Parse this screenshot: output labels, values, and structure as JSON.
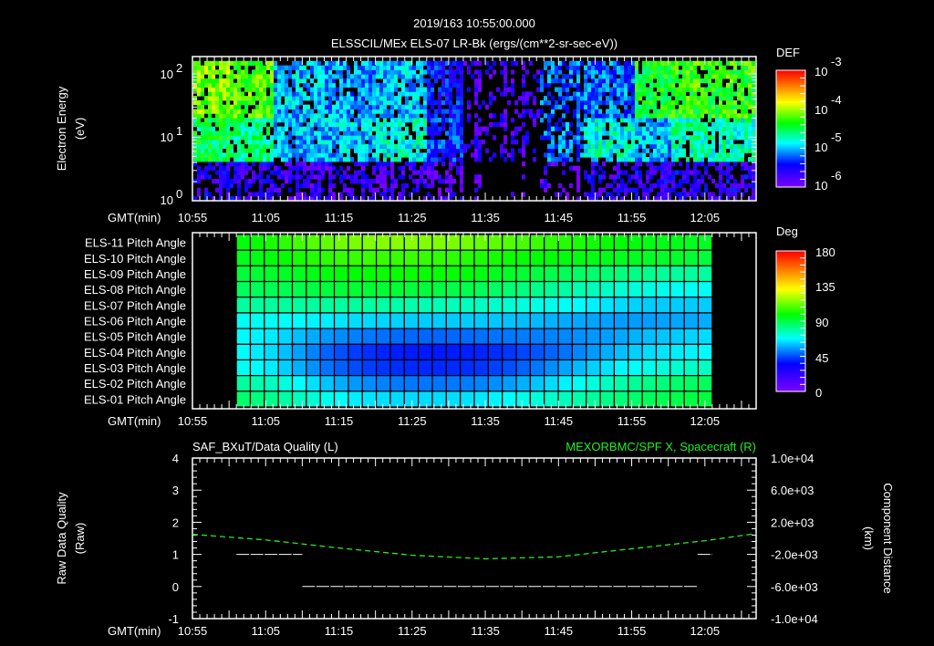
{
  "header": {
    "timestamp": "2019/163 10:55:00.000",
    "title": "ELSSCIL/MEx ELS-07 LR-Bk  (ergs/(cm**2-sr-sec-eV))"
  },
  "axis_time": {
    "label": "GMT(min)",
    "ticks": [
      "10:55",
      "11:05",
      "11:15",
      "11:25",
      "11:35",
      "11:45",
      "11:55",
      "12:05"
    ],
    "range": [
      "10:55",
      "12:12"
    ]
  },
  "chart_data": [
    {
      "type": "heatmap",
      "ylabel": "Electron Energy",
      "yunit": "(eV)",
      "yscale": "log",
      "ylim": [
        1,
        180
      ],
      "yticks": [
        "10",
        "10",
        "10"
      ],
      "ytick_exp": [
        "0",
        "1",
        "2"
      ],
      "colorbar": {
        "title": "DEF",
        "scale": "log",
        "range": [
          1e-06,
          0.001
        ],
        "labels": [
          "10",
          "10",
          "10",
          "10"
        ],
        "label_exp": [
          "-3",
          "-4",
          "-5",
          "-6"
        ]
      },
      "colormap": [
        "#7f00ff",
        "#0000ff",
        "#00ffff",
        "#00ff00",
        "#ffff00",
        "#ff0000"
      ],
      "bands": [
        "low 1-4 eV",
        "mid 4-20 eV",
        "high 20-180 eV"
      ],
      "time_bins": [
        {
          "t": "10:55",
          "log_def": [
            -5.6,
            -4.5,
            -4.1
          ],
          "coverage": 0.85
        },
        {
          "t": "11:00",
          "log_def": [
            -5.6,
            -4.6,
            -4.2
          ],
          "coverage": 0.85
        },
        {
          "t": "11:06",
          "log_def": [
            -5.7,
            -5.0,
            -5.0
          ],
          "coverage": 0.85
        },
        {
          "t": "11:13",
          "log_def": [
            -5.7,
            -5.0,
            -5.1
          ],
          "coverage": 0.85
        },
        {
          "t": "11:20",
          "log_def": [
            -5.7,
            -4.8,
            -5.0
          ],
          "coverage": 0.85
        },
        {
          "t": "11:27",
          "log_def": [
            -5.8,
            -5.3,
            -5.4
          ],
          "coverage": 0.75
        },
        {
          "t": "11:32",
          "log_def": [
            -5.9,
            -5.7,
            -5.7
          ],
          "coverage": 0.2
        },
        {
          "t": "11:42",
          "log_def": [
            -5.8,
            -5.2,
            -5.2
          ],
          "coverage": 0.55
        },
        {
          "t": "11:48",
          "log_def": [
            -5.6,
            -4.8,
            -5.2
          ],
          "coverage": 0.85
        },
        {
          "t": "11:55",
          "log_def": [
            -5.6,
            -5.0,
            -4.4
          ],
          "coverage": 0.85
        },
        {
          "t": "12:00",
          "log_def": [
            -5.6,
            -4.7,
            -4.3
          ],
          "coverage": 0.85
        }
      ]
    },
    {
      "type": "heatmap",
      "rows": [
        "ELS-11 Pitch Angle",
        "ELS-10 Pitch Angle",
        "ELS-09 Pitch Angle",
        "ELS-08 Pitch Angle",
        "ELS-07 Pitch Angle",
        "ELS-06 Pitch Angle",
        "ELS-05 Pitch Angle",
        "ELS-04 Pitch Angle",
        "ELS-03 Pitch Angle",
        "ELS-02 Pitch Angle",
        "ELS-01 Pitch Angle"
      ],
      "time_range": [
        "11:01",
        "12:06"
      ],
      "colorbar": {
        "title": "Deg",
        "range": [
          0,
          180
        ],
        "labels": [
          "180",
          "135",
          "90",
          "45",
          "0"
        ]
      },
      "values_deg": [
        [
          98,
          102,
          108,
          112,
          115,
          116,
          116,
          115,
          113,
          110,
          107,
          104,
          101,
          99,
          97,
          96,
          95
        ],
        [
          96,
          98,
          102,
          105,
          106,
          106,
          106,
          105,
          103,
          101,
          99,
          98,
          97,
          96,
          95,
          94,
          92
        ],
        [
          92,
          94,
          96,
          98,
          99,
          100,
          100,
          100,
          98,
          95,
          92,
          89,
          86,
          84,
          82,
          80,
          80
        ],
        [
          88,
          89,
          90,
          92,
          93,
          93,
          92,
          91,
          89,
          86,
          83,
          80,
          77,
          74,
          72,
          70,
          70
        ],
        [
          80,
          80,
          80,
          80,
          80,
          79,
          78,
          77,
          76,
          74,
          72,
          70,
          67,
          64,
          62,
          62,
          62
        ],
        [
          70,
          70,
          68,
          66,
          64,
          63,
          62,
          62,
          62,
          61,
          60,
          58,
          57,
          56,
          56,
          57,
          58
        ],
        [
          68,
          66,
          60,
          55,
          52,
          50,
          49,
          49,
          50,
          51,
          52,
          53,
          55,
          57,
          60,
          62,
          64
        ],
        [
          68,
          64,
          56,
          48,
          43,
          40,
          39,
          39,
          40,
          42,
          46,
          50,
          55,
          60,
          64,
          66,
          68
        ],
        [
          70,
          66,
          58,
          50,
          45,
          42,
          41,
          41,
          42,
          45,
          50,
          56,
          62,
          67,
          71,
          74,
          76
        ],
        [
          80,
          76,
          68,
          60,
          55,
          52,
          51,
          51,
          52,
          55,
          60,
          66,
          72,
          78,
          83,
          86,
          88
        ],
        [
          86,
          82,
          76,
          70,
          66,
          64,
          64,
          64,
          65,
          68,
          72,
          76,
          80,
          84,
          88,
          90,
          92
        ]
      ]
    },
    {
      "type": "line",
      "title_left": "SAF_BXuT/Data Quality (L)",
      "title_right": "MEXORBMC/SPF X, Spacecraft (R)",
      "ylabel_left": "Raw Data Quality",
      "yunit_left": "(Raw)",
      "ylim_left": [
        -1,
        4
      ],
      "yticks_left": [
        "4",
        "3",
        "2",
        "1",
        "0",
        "-1"
      ],
      "ylabel_right": "Component Distance",
      "yunit_right": "(km)",
      "ylim_right": [
        -10000,
        10000
      ],
      "yticks_right": [
        "1.0e+04",
        "6.0e+03",
        "2.0e+03",
        "-2.0e+03",
        "-6.0e+03",
        "-1.0e+04"
      ],
      "series": [
        {
          "axis": "left",
          "color": "#ffffff",
          "segments": [
            {
              "from": "11:01",
              "to": "11:10",
              "value": 1
            },
            {
              "from": "11:10",
              "to": "12:04",
              "value": 0
            },
            {
              "from": "12:04",
              "to": "12:06",
              "value": 1
            }
          ]
        },
        {
          "axis": "right",
          "color": "#22ee22",
          "style": "dashed",
          "x": [
            "10:55",
            "11:05",
            "11:15",
            "11:25",
            "11:35",
            "11:45",
            "11:55",
            "12:05",
            "12:12"
          ],
          "y": [
            500,
            -200,
            -1200,
            -2100,
            -2550,
            -2300,
            -1300,
            -300,
            600
          ]
        }
      ]
    }
  ]
}
